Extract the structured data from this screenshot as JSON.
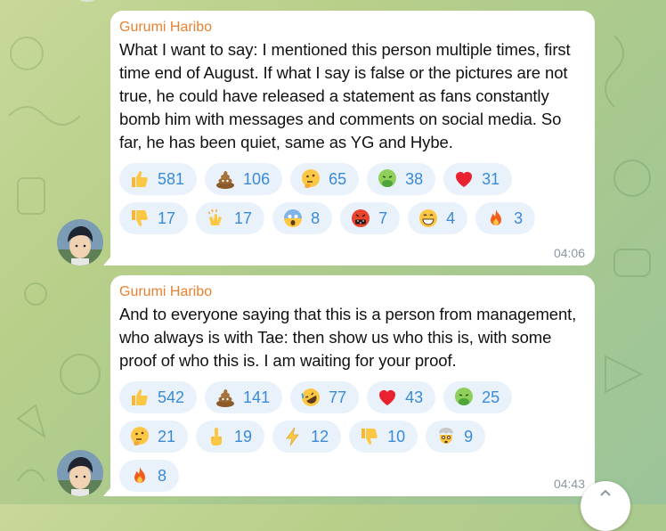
{
  "messages": [
    {
      "sender": "Gurumi Haribo",
      "text": "What I want to say: I mentioned this person multiple times, first time end of August. If what I say is false or the pictures are not true, he could have released a statement as fans constantly bomb him with messages and comments on social media. So far, he has been quiet, same as YG and Hybe.",
      "time": "04:06",
      "reactions": [
        {
          "icon": "thumbs-up-icon",
          "count": "581"
        },
        {
          "icon": "poop-icon",
          "count": "106"
        },
        {
          "icon": "thinking-face-icon",
          "count": "65"
        },
        {
          "icon": "nauseated-face-icon",
          "count": "38"
        },
        {
          "icon": "red-heart-icon",
          "count": "31"
        },
        {
          "icon": "thumbs-down-icon",
          "count": "17"
        },
        {
          "icon": "clapping-hands-icon",
          "count": "17"
        },
        {
          "icon": "screaming-face-icon",
          "count": "8"
        },
        {
          "icon": "cursing-face-icon",
          "count": "7"
        },
        {
          "icon": "grinning-face-icon",
          "count": "4"
        },
        {
          "icon": "fire-icon",
          "count": "3"
        }
      ]
    },
    {
      "sender": "Gurumi Haribo",
      "text": "And to everyone saying that this is a person from management, who always is with Tae: then show us who this is, with some proof of who this is. I am waiting for your proof.",
      "time": "04:43",
      "reactions": [
        {
          "icon": "thumbs-up-icon",
          "count": "542"
        },
        {
          "icon": "poop-icon",
          "count": "141"
        },
        {
          "icon": "rofl-face-icon",
          "count": "77"
        },
        {
          "icon": "red-heart-icon",
          "count": "43"
        },
        {
          "icon": "nauseated-face-icon",
          "count": "25"
        },
        {
          "icon": "thinking-face-icon",
          "count": "21"
        },
        {
          "icon": "middle-finger-icon",
          "count": "19"
        },
        {
          "icon": "lightning-icon",
          "count": "12"
        },
        {
          "icon": "thumbs-down-icon",
          "count": "10"
        },
        {
          "icon": "exploding-head-icon",
          "count": "9"
        },
        {
          "icon": "fire-icon",
          "count": "8"
        }
      ]
    }
  ],
  "colors": {
    "sender": "#e8812e",
    "reaction_count": "#3a8ad6",
    "reaction_bg": "#e9f2fb",
    "time": "#8a97a3"
  }
}
